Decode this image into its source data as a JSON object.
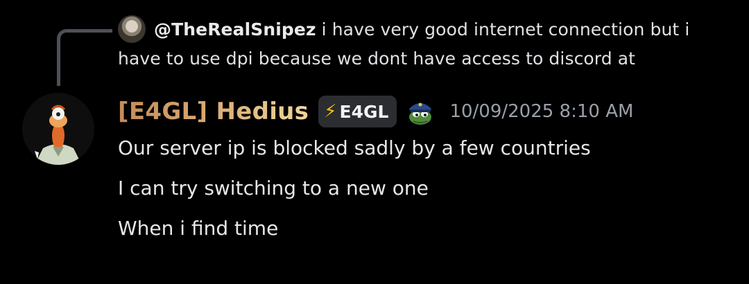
{
  "reply": {
    "author": "@TheRealSnipez",
    "text": "i have very good internet connection but i have to use dpi because we dont have access to discord at"
  },
  "message": {
    "username": "[E4GL] Hedius",
    "tag": {
      "icon": "lightning-icon",
      "label": "E4GL"
    },
    "role_emoji": "pepe-police-emoji",
    "timestamp": "10/09/2025 8:10 AM",
    "lines": [
      "Our server ip is blocked sadly by a few countries",
      "I can try switching to a new one",
      "When i find time"
    ]
  },
  "colors": {
    "background": "#000000",
    "reply_line": "#4e5058",
    "username_gradient_start": "#c58a58",
    "username_gradient_end": "#f0d79a",
    "tag_background": "#2b2d31",
    "timestamp": "#9aa0a8",
    "text": "#e6e7e9"
  }
}
